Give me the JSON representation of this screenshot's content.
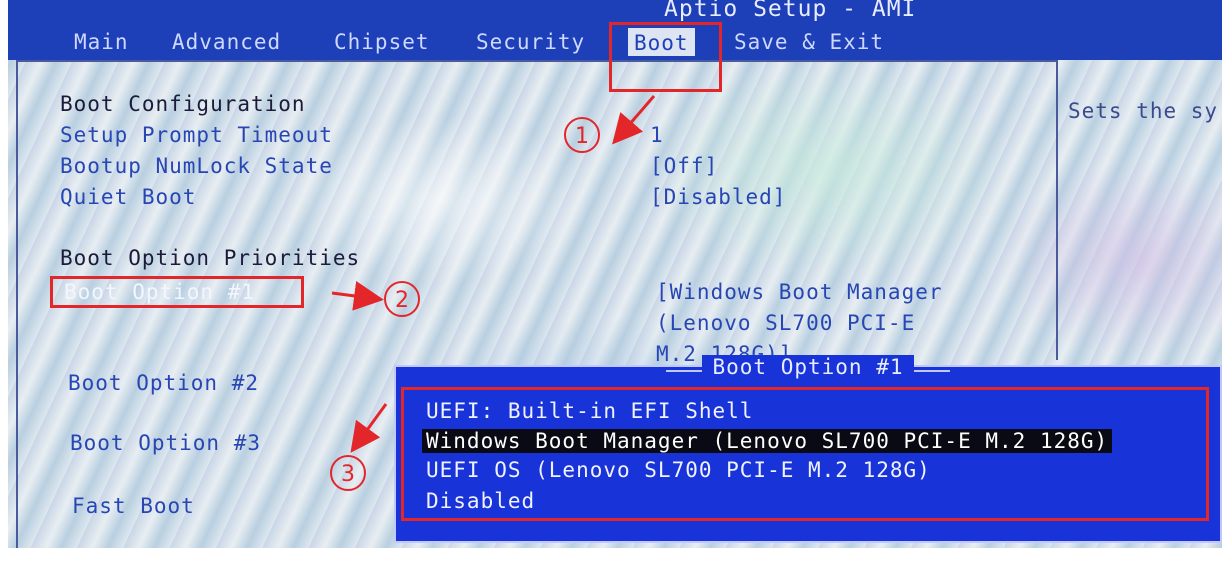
{
  "app_title": "Aptio Setup - AMI",
  "tabs": [
    {
      "label": "Main"
    },
    {
      "label": "Advanced"
    },
    {
      "label": "Chipset"
    },
    {
      "label": "Security"
    },
    {
      "label": "Boot",
      "active": true
    },
    {
      "label": "Save & Exit"
    }
  ],
  "boot_config": {
    "title": "Boot Configuration",
    "setup_prompt_timeout": {
      "label": "Setup Prompt Timeout",
      "value": "1"
    },
    "bootup_numlock": {
      "label": "Bootup NumLock State",
      "value": "[Off]"
    },
    "quiet_boot": {
      "label": "Quiet Boot",
      "value": "[Disabled]"
    }
  },
  "priorities": {
    "title": "Boot Option Priorities",
    "option1": {
      "label": "Boot Option #1",
      "value_lines": [
        "[Windows Boot Manager",
        "(Lenovo SL700 PCI-E",
        "M.2 128G)]"
      ]
    },
    "option2": {
      "label": "Boot Option #2"
    },
    "option3": {
      "label": "Boot Option #3"
    },
    "fast_boot": {
      "label": "Fast Boot"
    }
  },
  "help_text": "Sets the sy",
  "popup": {
    "title": "Boot Option #1",
    "options": [
      {
        "label": "UEFI: Built-in EFI Shell"
      },
      {
        "label": "Windows Boot Manager (Lenovo SL700 PCI-E M.2 128G)",
        "selected": true
      },
      {
        "label": "UEFI OS (Lenovo SL700 PCI-E M.2 128G)"
      },
      {
        "label": "Disabled"
      }
    ]
  },
  "annotations": {
    "step1": "1",
    "step2": "2",
    "step3": "3",
    "color": "#e3262a"
  },
  "colors": {
    "menubar": "#1d3fb8",
    "popup": "#1834d8",
    "item_text": "#2746b4"
  }
}
